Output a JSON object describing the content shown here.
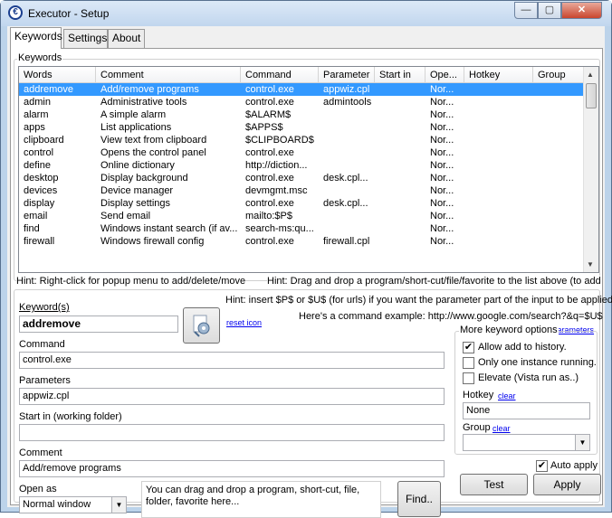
{
  "window": {
    "title": "Executor - Setup",
    "icon": "executor-app-icon",
    "min_glyph": "—",
    "max_glyph": "▢",
    "close_glyph": "✕"
  },
  "tabs": [
    "Keywords",
    "Settings",
    "About"
  ],
  "keywords_group": {
    "label": "Keywords"
  },
  "list": {
    "columns": [
      "Words",
      "Comment",
      "Command",
      "Parameter",
      "Start in",
      "Ope...",
      "Hotkey",
      "Group"
    ],
    "rows": [
      [
        "addremove",
        "Add/remove programs",
        "control.exe",
        "appwiz.cpl",
        "",
        "Nor...",
        "",
        ""
      ],
      [
        "admin",
        "Administrative tools",
        "control.exe",
        "admintools",
        "",
        "Nor...",
        "",
        ""
      ],
      [
        "alarm",
        "A simple alarm",
        "$ALARM$",
        "",
        "",
        "Nor...",
        "",
        ""
      ],
      [
        "apps",
        "List applications",
        "$APPS$",
        "",
        "",
        "Nor...",
        "",
        ""
      ],
      [
        "clipboard",
        "View text from clipboard",
        "$CLIPBOARD$",
        "",
        "",
        "Nor...",
        "",
        ""
      ],
      [
        "control",
        "Opens the control panel",
        "control.exe",
        "",
        "",
        "Nor...",
        "",
        ""
      ],
      [
        "define",
        "Online dictionary",
        "http://diction...",
        "",
        "",
        "Nor...",
        "",
        ""
      ],
      [
        "desktop",
        "Display background",
        "control.exe",
        "desk.cpl...",
        "",
        "Nor...",
        "",
        ""
      ],
      [
        "devices",
        "Device manager",
        "devmgmt.msc",
        "",
        "",
        "Nor...",
        "",
        ""
      ],
      [
        "display",
        "Display settings",
        "control.exe",
        "desk.cpl...",
        "",
        "Nor...",
        "",
        ""
      ],
      [
        "email",
        "Send email",
        "mailto:$P$",
        "",
        "",
        "Nor...",
        "",
        ""
      ],
      [
        "find",
        "Windows instant search (if av...",
        "search-ms:qu...",
        "",
        "",
        "Nor...",
        "",
        ""
      ],
      [
        "firewall",
        "Windows firewall config",
        "control.exe",
        "firewall.cpl",
        "",
        "Nor...",
        "",
        ""
      ]
    ],
    "selected_index": 0
  },
  "hints": {
    "left": "Hint: Right-click for popup menu to add/delete/move",
    "right": "Hint: Drag and drop a program/short-cut/file/favorite to the list above (to add)",
    "param1": "Hint: insert $P$ or $U$ (for urls) if you want the parameter part of the input to be applied.",
    "param2": "Here's a command example: http://www.google.com/search?&q=$U$",
    "more_info": "more info on parameters"
  },
  "form": {
    "keyword_label": "Keyword(s)",
    "keyword_value": "addremove",
    "reset_icon": "reset icon",
    "command_label": "Command",
    "command_value": "control.exe",
    "parameters_label": "Parameters",
    "parameters_value": "appwiz.cpl",
    "startin_label": "Start in (working folder)",
    "startin_value": "",
    "comment_label": "Comment",
    "comment_value": "Add/remove programs",
    "openas_label": "Open as",
    "openas_value": "Normal window",
    "drop_text": "You can drag and drop a program, short-cut, file, folder, favorite here...",
    "find_button": "Find.."
  },
  "options": {
    "label": "More keyword options",
    "allow_history": "Allow add to history.",
    "allow_history_checked": true,
    "one_instance": "Only one instance running.",
    "one_instance_checked": false,
    "elevate": "Elevate (Vista run as..)",
    "elevate_checked": false,
    "hotkey_label": "Hotkey",
    "hotkey_clear": "clear",
    "hotkey_value": "None",
    "group_label": "Group",
    "group_clear": "clear",
    "group_value": ""
  },
  "bottom": {
    "auto_apply": "Auto apply",
    "auto_apply_checked": true,
    "test": "Test",
    "apply": "Apply"
  }
}
